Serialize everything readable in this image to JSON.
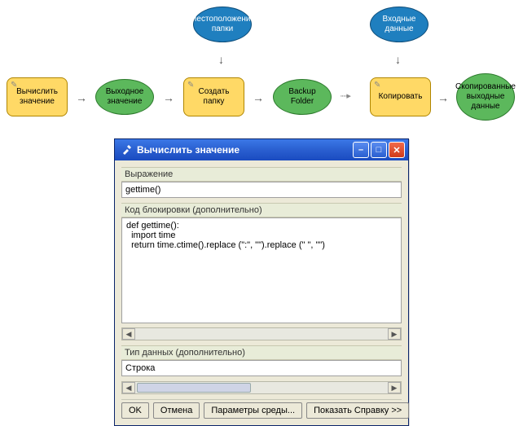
{
  "diagram": {
    "nodes": {
      "compute": "Вычислить значение",
      "output": "Выходное значение",
      "folderloc": "Местоположение папки",
      "createfolder": "Создать папку",
      "backup": "Backup Folder",
      "copy": "Копировать",
      "inputdata": "Входные данные",
      "copiedout": "Скопированные выходные данные"
    }
  },
  "window": {
    "title": "Вычислить значение",
    "labels": {
      "expression": "Выражение",
      "codeblock": "Код блокировки (дополнительно)",
      "datatype": "Тип данных (дополнительно)"
    },
    "values": {
      "expression": "gettime()",
      "codeblock": "def gettime():\n  import time\n  return time.ctime().replace (\":\", \"\").replace (\" \", \"\")",
      "datatype": "Строка"
    },
    "buttons": {
      "ok": "OK",
      "cancel": "Отмена",
      "env": "Параметры среды...",
      "help": "Показать Справку >>"
    }
  }
}
